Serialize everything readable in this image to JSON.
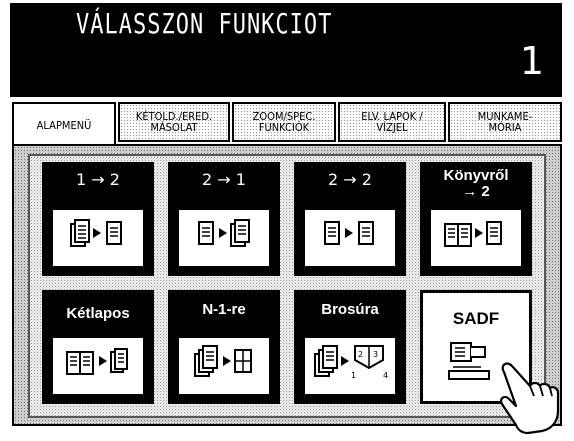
{
  "header": {
    "title": "VÁLASSZON FUNKCIOT",
    "page_number": "1"
  },
  "tabs": [
    {
      "label": "ALAPMENÜ",
      "active": true
    },
    {
      "label": "KÉTOLD./ERED.\nMÁSOLAT",
      "active": false
    },
    {
      "label": "ZOOM/SPEC.\nFUNKCIÓK",
      "active": false
    },
    {
      "label": "ELV. LAPOK /\nVÍZJEL",
      "active": false
    },
    {
      "label": "MUNKAME-\nMÓRIA",
      "active": false
    }
  ],
  "functions": [
    {
      "label": "1 → 2",
      "icon": "duplex-1to2-icon"
    },
    {
      "label": "2 → 1",
      "icon": "duplex-2to1-icon"
    },
    {
      "label": "2 → 2",
      "icon": "duplex-2to2-icon"
    },
    {
      "label": "Könyvről\n→ 2",
      "icon": "book-to-duplex-icon"
    },
    {
      "label": "Kétlapos",
      "icon": "two-page-icon"
    },
    {
      "label": "N-1-re",
      "icon": "n-up-icon"
    },
    {
      "label": "Brosúra",
      "icon": "booklet-icon"
    },
    {
      "label": "SADF",
      "icon": "sadf-feeder-icon"
    }
  ]
}
